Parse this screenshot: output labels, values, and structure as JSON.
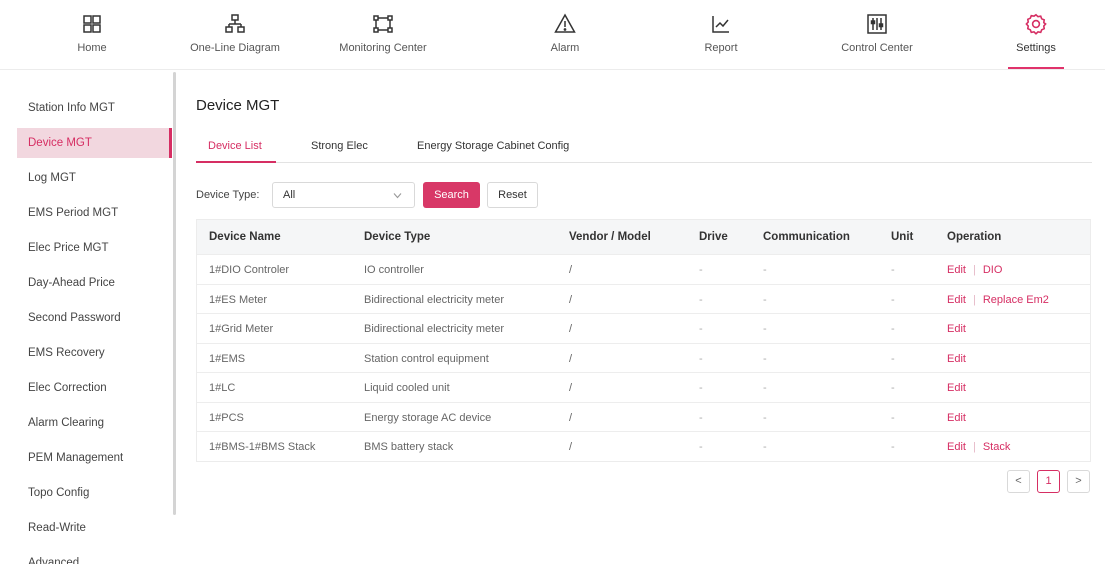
{
  "nav": [
    {
      "id": "home",
      "label": "Home",
      "icon": "home-grid-icon"
    },
    {
      "id": "one-line-diagram",
      "label": "One-Line Diagram",
      "icon": "network-icon"
    },
    {
      "id": "monitoring-center",
      "label": "Monitoring Center",
      "icon": "monitor-frame-icon"
    },
    {
      "id": "alarm",
      "label": "Alarm",
      "icon": "warning-triangle-icon"
    },
    {
      "id": "report",
      "label": "Report",
      "icon": "line-chart-icon"
    },
    {
      "id": "control-center",
      "label": "Control Center",
      "icon": "sliders-icon"
    },
    {
      "id": "settings",
      "label": "Settings",
      "icon": "gear-icon",
      "active": true
    }
  ],
  "sidebar": {
    "items": [
      {
        "label": "Station Info MGT"
      },
      {
        "label": "Device MGT",
        "active": true
      },
      {
        "label": "Log MGT"
      },
      {
        "label": "EMS Period MGT"
      },
      {
        "label": "Elec Price MGT"
      },
      {
        "label": "Day-Ahead Price"
      },
      {
        "label": "Second Password"
      },
      {
        "label": "EMS Recovery"
      },
      {
        "label": "Elec Correction"
      },
      {
        "label": "Alarm Clearing"
      },
      {
        "label": "PEM Management"
      },
      {
        "label": "Topo Config"
      },
      {
        "label": "Read-Write"
      },
      {
        "label": "Advanced"
      }
    ]
  },
  "page": {
    "title": "Device MGT",
    "tabs": [
      {
        "label": "Device List",
        "active": true
      },
      {
        "label": "Strong Elec"
      },
      {
        "label": "Energy Storage Cabinet Config"
      }
    ]
  },
  "filter": {
    "label": "Device Type:",
    "selected": "All",
    "search_label": "Search",
    "reset_label": "Reset"
  },
  "table": {
    "columns": [
      "Device Name",
      "Device Type",
      "Vendor / Model",
      "Drive",
      "Communication",
      "Unit",
      "Operation"
    ],
    "rows": [
      {
        "name": "1#DIO Controler",
        "type": "IO controller",
        "vendor": "/",
        "drive": "-",
        "comm": "-",
        "unit": "-",
        "ops": [
          "Edit",
          "DIO"
        ]
      },
      {
        "name": "1#ES Meter",
        "type": "Bidirectional electricity meter",
        "vendor": "/",
        "drive": "-",
        "comm": "-",
        "unit": "-",
        "ops": [
          "Edit",
          "Replace Em2"
        ]
      },
      {
        "name": "1#Grid Meter",
        "type": "Bidirectional electricity meter",
        "vendor": "/",
        "drive": "-",
        "comm": "-",
        "unit": "-",
        "ops": [
          "Edit"
        ]
      },
      {
        "name": "1#EMS",
        "type": "Station control equipment",
        "vendor": "/",
        "drive": "-",
        "comm": "-",
        "unit": "-",
        "ops": [
          "Edit"
        ]
      },
      {
        "name": "1#LC",
        "type": "Liquid cooled unit",
        "vendor": "/",
        "drive": "-",
        "comm": "-",
        "unit": "-",
        "ops": [
          "Edit"
        ]
      },
      {
        "name": "1#PCS",
        "type": "Energy storage AC device",
        "vendor": "/",
        "drive": "-",
        "comm": "-",
        "unit": "-",
        "ops": [
          "Edit"
        ]
      },
      {
        "name": "1#BMS-1#BMS Stack",
        "type": "BMS battery stack",
        "vendor": "/",
        "drive": "-",
        "comm": "-",
        "unit": "-",
        "ops": [
          "Edit",
          "Stack"
        ]
      }
    ]
  },
  "pagination": {
    "prev": "<",
    "current": "1",
    "next": ">"
  },
  "colors": {
    "accent": "#d62e63",
    "active_bg": "#f2d7df"
  }
}
